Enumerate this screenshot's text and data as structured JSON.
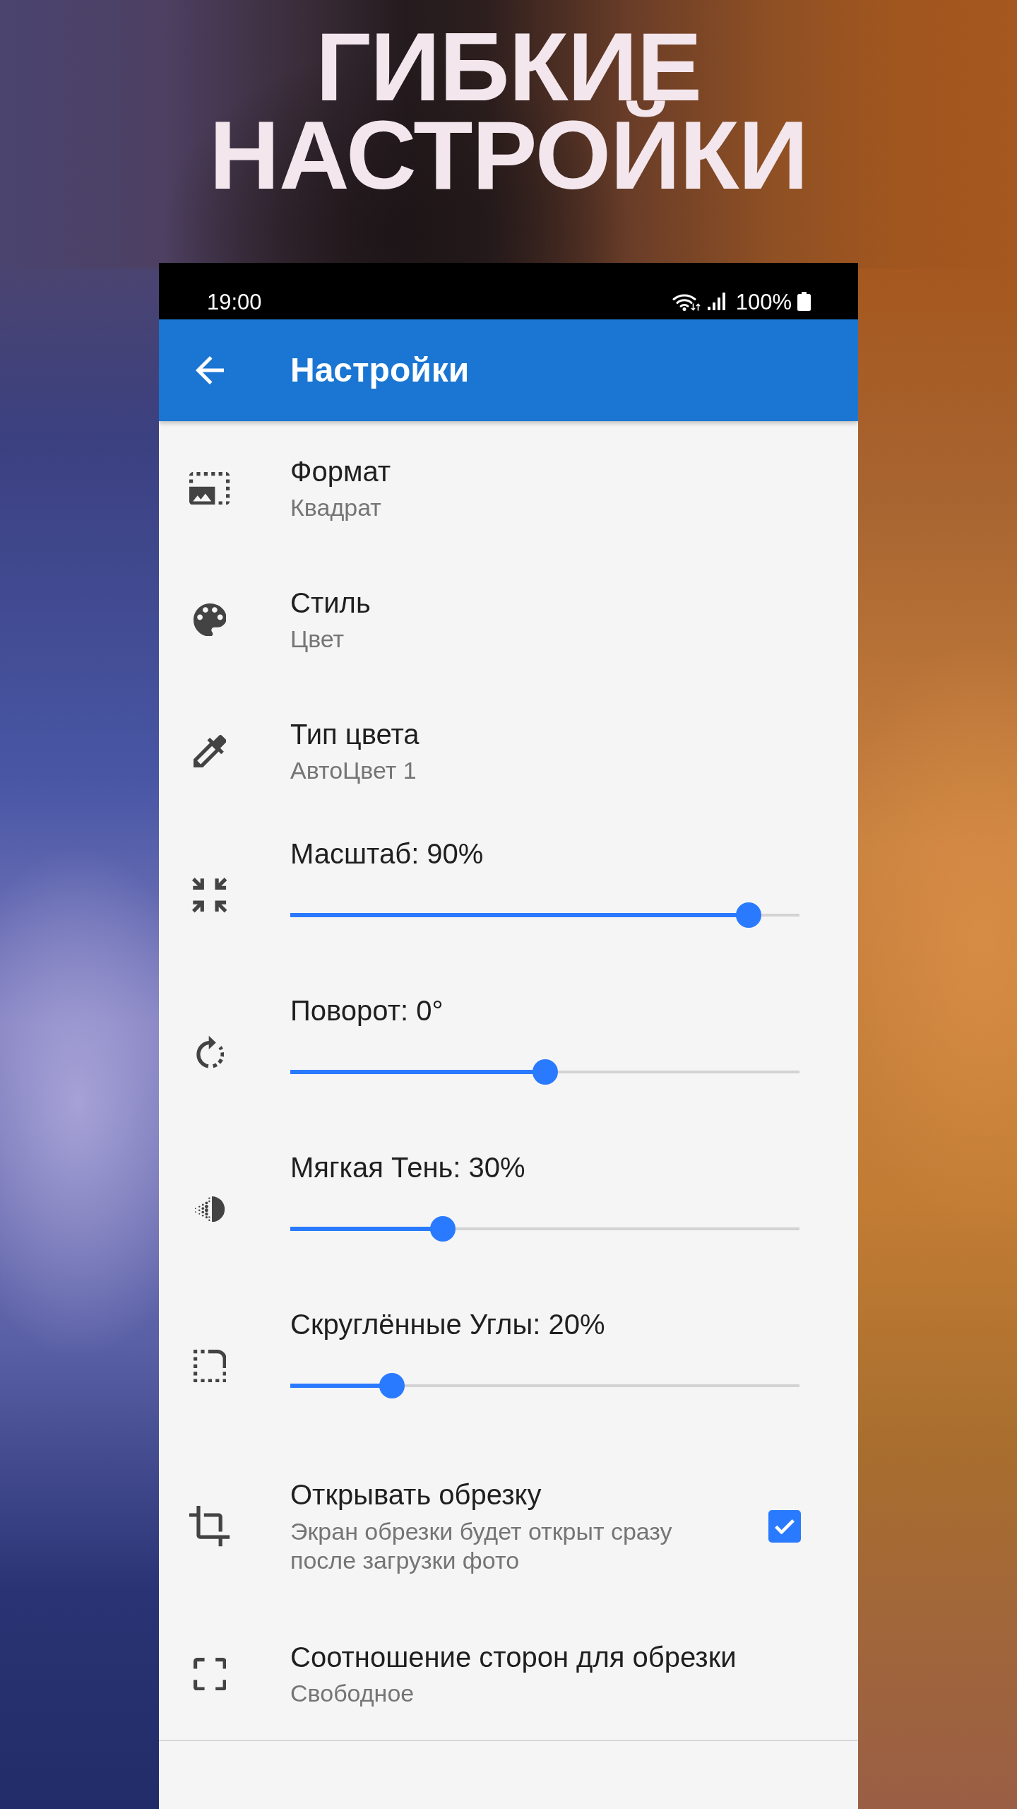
{
  "headline": "ГИБКИЕ НАСТРОЙКИ",
  "status_bar": {
    "time": "19:00",
    "battery": "100%"
  },
  "app_bar": {
    "title": "Настройки"
  },
  "settings": [
    {
      "kind": "choice",
      "title": "Формат",
      "value": "Квадрат"
    },
    {
      "kind": "choice",
      "title": "Стиль",
      "value": "Цвет"
    },
    {
      "kind": "choice",
      "title": "Тип цвета",
      "value": "АвтоЦвет 1"
    },
    {
      "kind": "slider",
      "title": "Масштаб: 90%",
      "level": 0.9
    },
    {
      "kind": "slider",
      "title": "Поворот: 0°",
      "level": 0.5
    },
    {
      "kind": "slider",
      "title": "Мягкая Тень: 30%",
      "level": 0.3
    },
    {
      "kind": "slider",
      "title": "Скруглённые Углы: 20%",
      "level": 0.2
    },
    {
      "kind": "checkbox",
      "title": "Открывать обрезку",
      "value": "Экран обрезки будет открыт сразу после загрузки фото",
      "checked": true
    },
    {
      "kind": "choice",
      "title": "Соотношение сторон для обрезки",
      "value": "Свободное"
    }
  ]
}
